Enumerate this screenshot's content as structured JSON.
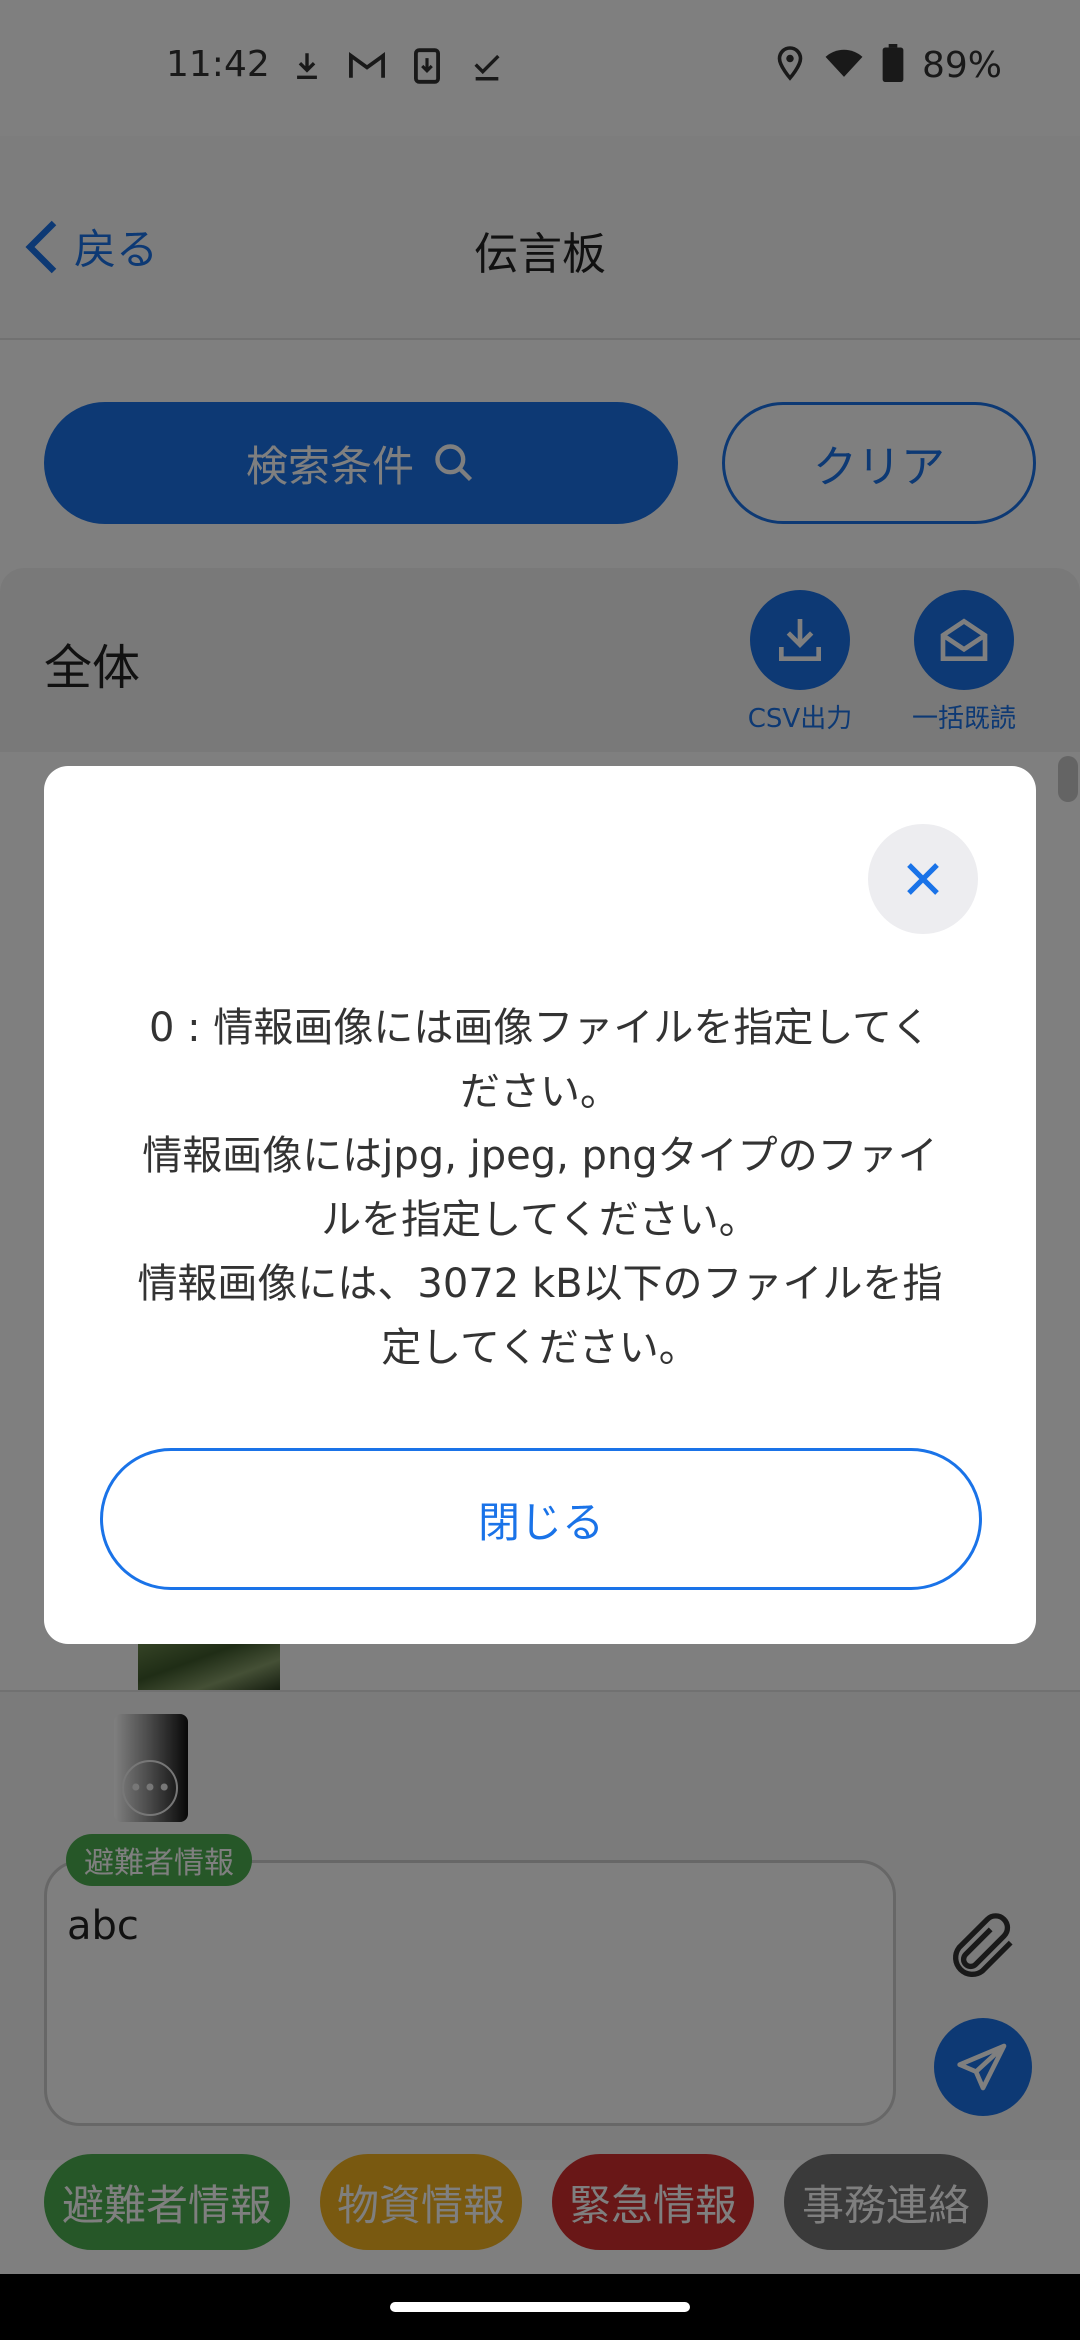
{
  "status_bar": {
    "time": "11:42",
    "icons_left": [
      "download-icon",
      "gmail-icon",
      "sim-download-icon",
      "check-icon"
    ],
    "icons_right": [
      "location-icon",
      "wifi-icon",
      "battery-icon"
    ],
    "battery": "89%"
  },
  "nav": {
    "back_label": "戻る",
    "title": "伝言板"
  },
  "filters": {
    "search_label": "検索条件",
    "clear_label": "クリア"
  },
  "section": {
    "title": "全体",
    "csv_label": "CSV出力",
    "mark_all_read_label": "一括既読"
  },
  "dialog": {
    "message_lines": [
      "0 : 情報画像には画像ファイルを指定してく",
      "ださい。",
      "情報画像にはjpg, jpeg, pngタイプのファイ",
      "ルを指定してください。",
      "情報画像には、3072 kB以下のファイルを指",
      "定してください。"
    ],
    "close_button_label": "閉じる"
  },
  "composer": {
    "tag": "避難者情報",
    "text": "abc"
  },
  "categories": [
    {
      "label": "避難者情報",
      "color": "#4caf50"
    },
    {
      "label": "物資情報",
      "color": "#f2b321"
    },
    {
      "label": "緊急情報",
      "color": "#d32f2f"
    },
    {
      "label": "事務連絡",
      "color": "#757575"
    }
  ],
  "colors": {
    "accent": "#1a73e8",
    "scrim": "rgba(0,0,0,0.5)"
  }
}
